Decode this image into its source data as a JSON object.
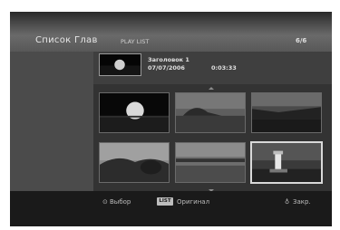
{
  "header": {
    "title": "Список Глав",
    "subtitle": "PLAY LIST",
    "pager": "6/6"
  },
  "info": {
    "title": "Заголовок 1",
    "date": "07/07/2006",
    "time": "0:03:33"
  },
  "footer": {
    "select_icon": "⊙",
    "select_label": "Выбор",
    "list_badge": "LIST",
    "list_label": "Оригинал",
    "close_icon": "♁",
    "close_label": "Закр."
  },
  "thumbnails": [
    "sun",
    "island",
    "coast",
    "bushes",
    "shoreline",
    "lighthouse"
  ],
  "selected_thumbnail": "lighthouse"
}
